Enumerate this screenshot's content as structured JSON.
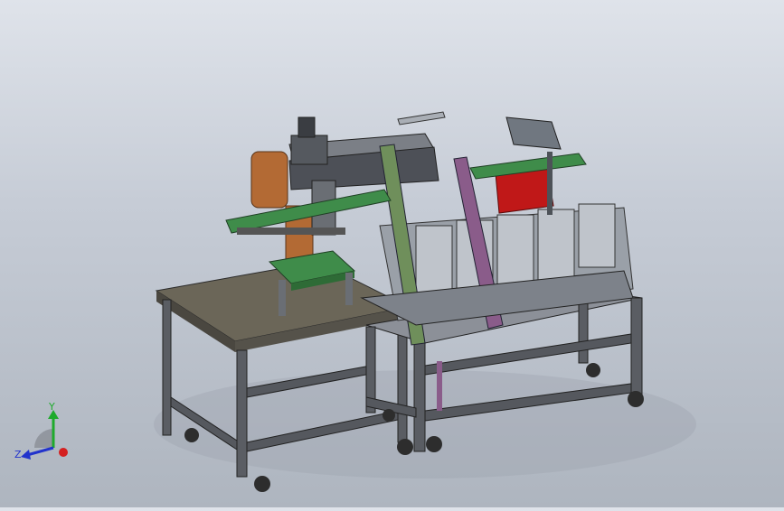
{
  "triad": {
    "y_label": "Y",
    "z_label": "Z",
    "colors": {
      "y": "#1faa2c",
      "z": "#2233cc",
      "x": "#d42020"
    }
  },
  "model": {
    "colors": {
      "frame": "#5a5d63",
      "table_top": "#6b6658",
      "conveyor_green": "#3f8c4a",
      "orange_roll": "#b36a34",
      "red_box": "#c01818",
      "green_post": "#6f8f5b",
      "purple_post": "#8a5c8a"
    }
  }
}
